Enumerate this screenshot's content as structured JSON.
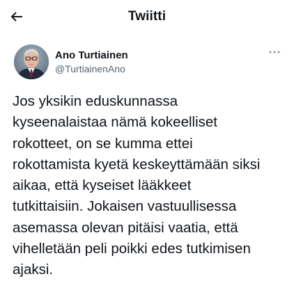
{
  "header": {
    "title": "Twiitti",
    "back_icon": "arrow-left-icon"
  },
  "tweet": {
    "author": {
      "display_name": "Ano Turtiainen",
      "handle": "@TurtiainenAno",
      "avatar": "profile-photo"
    },
    "more_icon": "more-horizontal-icon",
    "text": "Jos yksikin eduskunnassa\nkyseenalaistaa nämä kokeelliset\nrokotteet, on se kumma ettei\nrokottamista kyetä keskeyttämään siksi\naikaa, että kyseiset lääkkeet\ntutkittaisiin. Jokaisen vastuullisessa\nasemassa olevan pitäisi vaatia, että\nvihelletään peli poikki edes tutkimisen\najaksi."
  },
  "colors": {
    "text": "#0f1419",
    "secondary": "#536471",
    "background": "#ffffff"
  }
}
